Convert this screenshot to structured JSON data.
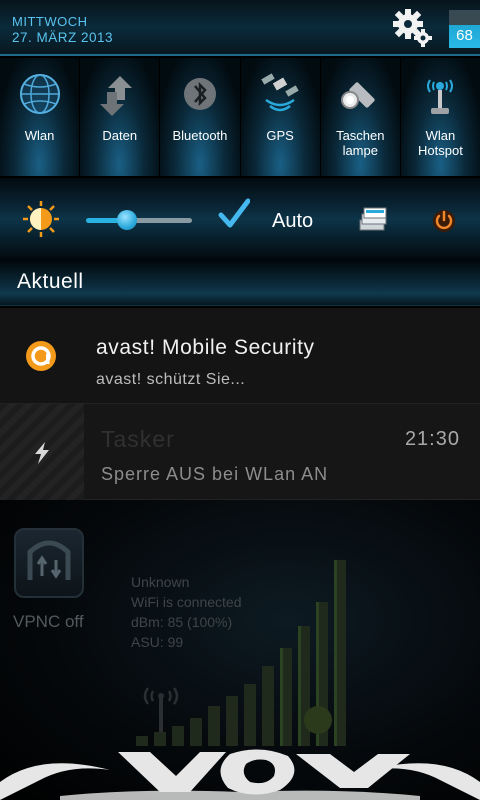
{
  "status_header": {
    "day": "MITTWOCH",
    "date": "27. MÄRZ 2013",
    "battery_level": "68",
    "battery_fraction": 0.68,
    "accent_color": "#59c3ef"
  },
  "toggles": [
    {
      "label": "Wlan",
      "icon": "globe-icon"
    },
    {
      "label": "Daten",
      "icon": "data-arrows-icon"
    },
    {
      "label": "Bluetooth",
      "icon": "bluetooth-icon"
    },
    {
      "label": "GPS",
      "icon": "satellite-icon"
    },
    {
      "label": "Taschen\nlampe",
      "label_line1": "Taschen",
      "label_line2": "lampe",
      "icon": "flashlight-icon"
    },
    {
      "label": "Wlan\nHotspot",
      "label_line1": "Wlan",
      "label_line2": "Hotspot",
      "icon": "hotspot-icon"
    }
  ],
  "brightness": {
    "auto_label": "Auto",
    "auto_checked": true,
    "level_fraction": 0.38
  },
  "notifications_header": {
    "title": "Aktuell"
  },
  "notifications": [
    {
      "app": "avast! Mobile Security",
      "text": "avast! schützt Sie...",
      "icon": "avast-icon"
    },
    {
      "app": "Tasker",
      "text": "Sperre AUS bei WLan AN",
      "time": "21:30",
      "icon": "tasker-bolt-icon"
    }
  ],
  "home_widgets": {
    "vpnc_label": "VPNC off",
    "wifi_lines": [
      "Unknown",
      "WiFi is connected",
      "dBm: 85 (100%)",
      "ASU: 99"
    ]
  }
}
